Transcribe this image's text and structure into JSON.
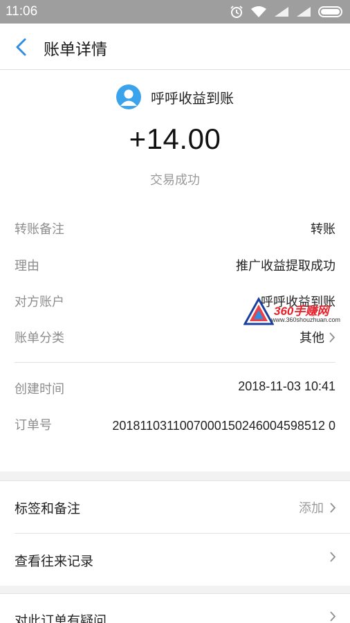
{
  "status_bar": {
    "time": "11:06"
  },
  "header": {
    "title": "账单详情"
  },
  "summary": {
    "payee": "呼呼收益到账",
    "amount": "+14.00",
    "status": "交易成功"
  },
  "details": [
    {
      "label": "转账备注",
      "value": "转账"
    },
    {
      "label": "理由",
      "value": "推广收益提取成功"
    },
    {
      "label": "对方账户",
      "value": "呼呼收益到账"
    },
    {
      "label": "账单分类",
      "value": "其他"
    }
  ],
  "meta": {
    "created_label": "创建时间",
    "created_value": "2018-11-03 10:41",
    "order_label": "订单号",
    "order_value": "2018110311007000150246004598512 0"
  },
  "actions": {
    "tags_label": "标签和备注",
    "tags_action": "添加",
    "history_label": "查看往来记录",
    "question_label": "对此订单有疑问"
  },
  "watermark": {
    "brand": "360手赚网",
    "url": "www.360shouzhuan.com"
  },
  "colors": {
    "accent": "#3ba3ec",
    "status_bar": "#9e9e9e",
    "watermark_red": "#e8202a"
  }
}
